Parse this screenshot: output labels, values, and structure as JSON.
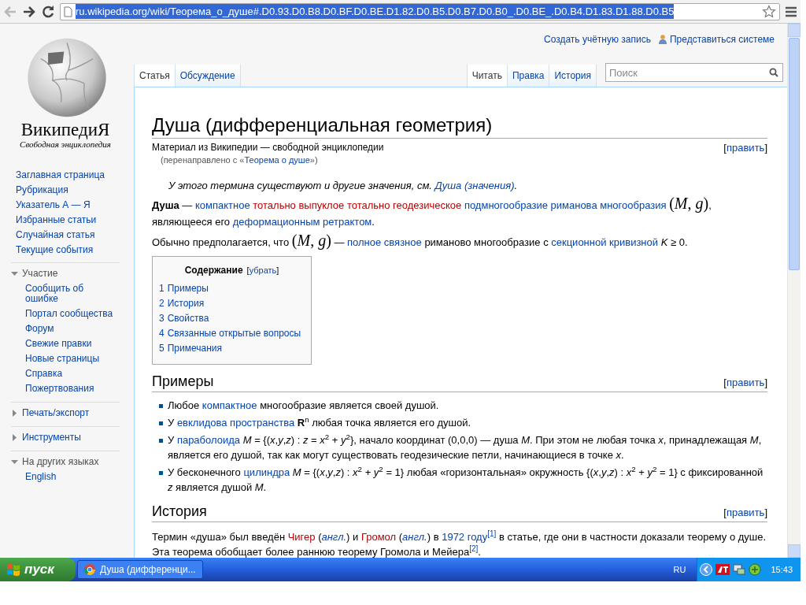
{
  "browser": {
    "url": "ru.wikipedia.org/wiki/Теорема_о_душе#.D0.93.D0.B8.D0.BF.D0.BE.D1.82.D0.B5.D0.B7.D0.B0_.D0.BE_.D0.B4.D1.83.D1.88.D0.B5",
    "url_selected": true,
    "back_disabled": true
  },
  "personal": [
    {
      "label": "Создать учётную запись",
      "kind": "plain"
    },
    {
      "label": "Представиться системе",
      "kind": "user"
    }
  ],
  "left_tabs": [
    {
      "label": "Статья",
      "selected": true
    },
    {
      "label": "Обсуждение",
      "selected": false
    }
  ],
  "right_tabs": [
    {
      "label": "Читать",
      "selected": true
    },
    {
      "label": "Правка",
      "selected": false
    },
    {
      "label": "История",
      "selected": false
    }
  ],
  "search": {
    "placeholder": "Поиск"
  },
  "logo": {
    "wordmark": "ВикипедиЯ",
    "tagline": "Свободная энциклопедия"
  },
  "sidebar": {
    "main": [
      "Заглавная страница",
      "Рубрикация",
      "Указатель А — Я",
      "Избранные статьи",
      "Случайная статья",
      "Текущие события"
    ],
    "sections": [
      {
        "title": "Участие",
        "expanded": true,
        "items": [
          "Сообщить об ошибке",
          "Портал сообщества",
          "Форум",
          "Свежие правки",
          "Новые страницы",
          "Справка",
          "Пожертвования"
        ]
      },
      {
        "title": "Печать/экспорт",
        "expanded": false
      },
      {
        "title": "Инструменты",
        "expanded": false
      },
      {
        "title": "На других языках",
        "expanded": true,
        "items": [
          "English"
        ]
      }
    ]
  },
  "article": {
    "title": "Душа (дифференциальная геометрия)",
    "site_sub": "Материал из Википедии — свободной энциклопедии",
    "edit": [
      "[",
      "править",
      "]"
    ],
    "redirect": [
      {
        "kind": "plain",
        "t": "(перенаправлено с «"
      },
      {
        "kind": "link",
        "t": "Теорема о душе"
      },
      {
        "kind": "plain",
        "t": "»)"
      }
    ],
    "hatnote": [
      {
        "kind": "plain",
        "t": "У этого термина существуют и другие значения, см. "
      },
      {
        "kind": "link",
        "t": "Душа (значения)"
      },
      {
        "kind": "plain",
        "t": "."
      }
    ],
    "paragraphs": [
      [
        {
          "kind": "plain",
          "t": "**Душа** — "
        },
        {
          "kind": "link",
          "t": "компактное"
        },
        {
          "kind": "new",
          "t": "тотально выпуклое",
          "space_before": true
        },
        {
          "kind": "new",
          "t": "тотально геодезическое",
          "space_before": true
        },
        {
          "kind": "link",
          "t": "подмногообразие",
          "space_before": true
        },
        {
          "kind": "link",
          "t": "риманова многообразия",
          "space_before": true
        },
        {
          "kind": "math",
          "t": "(*M*, *g*)",
          "space_before": true
        },
        {
          "kind": "plain",
          "t": ", являющееся его "
        },
        {
          "kind": "link",
          "t": "деформационным ретрактом"
        },
        {
          "kind": "plain",
          "t": "."
        }
      ],
      [
        {
          "kind": "plain",
          "t": "Обычно предполагается, что "
        },
        {
          "kind": "math",
          "t": "(*M*, *g*)"
        },
        {
          "kind": "plain",
          "t": " — "
        },
        {
          "kind": "link",
          "t": "полное связное"
        },
        {
          "kind": "plain",
          "t": " риманово многообразие с "
        },
        {
          "kind": "link",
          "t": "секционной кривизной"
        },
        {
          "kind": "plain",
          "t": " *K* ≥ 0."
        }
      ]
    ],
    "toc": {
      "title": "Содержание",
      "toggle": [
        "[",
        "убрать",
        "]"
      ],
      "items": [
        {
          "number": "1",
          "label": "Примеры"
        },
        {
          "number": "2",
          "label": "История"
        },
        {
          "number": "3",
          "label": "Свойства"
        },
        {
          "number": "4",
          "label": "Связанные открытые вопросы"
        },
        {
          "number": "5",
          "label": "Примечания"
        }
      ]
    },
    "sections": [
      {
        "heading": "Примеры",
        "edit": [
          "[",
          "править",
          "]"
        ],
        "bullets": [
          [
            {
              "kind": "plain",
              "t": "Любое "
            },
            {
              "kind": "link",
              "t": "компактное"
            },
            {
              "kind": "plain",
              "t": " многообразие является своей душой."
            }
          ],
          [
            {
              "kind": "plain",
              "t": "У "
            },
            {
              "kind": "link",
              "t": "евклидова пространства"
            },
            {
              "kind": "plain",
              "t": " **R**$^{n}$ любая точка является его душой."
            }
          ],
          [
            {
              "kind": "plain",
              "t": "У "
            },
            {
              "kind": "link",
              "t": "параболоида"
            },
            {
              "kind": "plain",
              "t": " *M* = {(*x*,*y*,*z*) : *z* = *x*$^{2}$ + *y*$^{2}$}, начало координат (0,0,0) — душа *M*. При этом не любая точка *x*, принадлежащая *M*, является его душой, так как могут существовать геодезические петли, начинающиеся в точке *x*."
            }
          ],
          [
            {
              "kind": "plain",
              "t": "У бесконечного "
            },
            {
              "kind": "link",
              "t": "цилиндра"
            },
            {
              "kind": "plain",
              "t": " *M* = {(*x*,*y*,*z*) : *x*$^{2}$ + *y*$^{2}$ = 1} любая «горизонтальная» окружность {(*x*,*y*,*z*) : *x*$^{2}$ + *y*$^{2}$ = 1} с фиксированной *z* является душой *M*."
            }
          ]
        ]
      },
      {
        "heading": "История",
        "edit": [
          "[",
          "править",
          "]"
        ],
        "paragraphs": [
          [
            {
              "kind": "plain",
              "t": "Термин «душа» был введён "
            },
            {
              "kind": "new",
              "t": "Чигер"
            },
            {
              "kind": "plain",
              "t": " ("
            },
            {
              "kind": "ilink",
              "t": "англ."
            },
            {
              "kind": "plain",
              "t": ") и "
            },
            {
              "kind": "new",
              "t": "Громол"
            },
            {
              "kind": "plain",
              "t": " ("
            },
            {
              "kind": "ilink",
              "t": "англ."
            },
            {
              "kind": "plain",
              "t": ") в "
            },
            {
              "kind": "link",
              "t": "1972 году"
            },
            {
              "kind": "ref",
              "t": "[1]"
            },
            {
              "kind": "plain",
              "t": " в статье, где они в частности доказали теорему о душе. Эта теорема обобщает более раннюю теорему Громола и Мейера"
            },
            {
              "kind": "ref",
              "t": "[2]"
            },
            {
              "kind": "plain",
              "t": "."
            }
          ]
        ]
      }
    ]
  },
  "taskbar": {
    "start": "пуск",
    "tasks": [
      {
        "label": "Душа (дифференци...",
        "selected": false
      }
    ],
    "language": "RU",
    "clock": "15:43"
  }
}
